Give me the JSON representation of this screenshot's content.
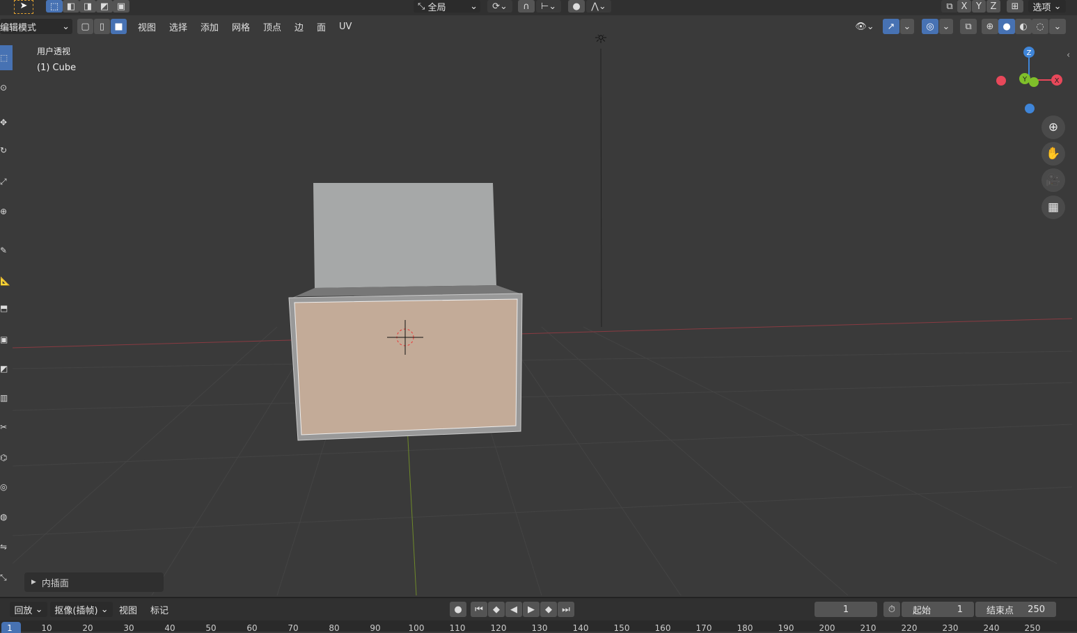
{
  "header": {
    "transform_orientation": "全局",
    "options_label": "选项",
    "axes": [
      "X",
      "Y",
      "Z"
    ]
  },
  "toolbar": {
    "mode": "编辑模式",
    "menus": [
      "视图",
      "选择",
      "添加",
      "网格",
      "顶点",
      "边",
      "面",
      "UV"
    ]
  },
  "viewport": {
    "view_name": "用户透视",
    "object_name": "(1) Cube",
    "gizmo": {
      "z": "Z",
      "y": "Y",
      "x": "X"
    }
  },
  "operator_panel": {
    "label": "内插面"
  },
  "timeline": {
    "menus": [
      "回放",
      "抠像(插帧)",
      "视图",
      "标记"
    ],
    "current_frame": "1",
    "start_label": "起始",
    "start": "1",
    "end_label": "结束点",
    "end": "250",
    "ruler": [
      "1",
      "10",
      "20",
      "30",
      "40",
      "50",
      "60",
      "70",
      "80",
      "90",
      "100",
      "110",
      "120",
      "130",
      "140",
      "150",
      "160",
      "170",
      "180",
      "190",
      "200",
      "210",
      "220",
      "230",
      "240",
      "250"
    ]
  },
  "colors": {
    "accent": "#4772b3",
    "face": "#c3ab98",
    "x_axis": "#e8485a",
    "y_axis": "#7fbf2a",
    "z_axis": "#3f85d8"
  }
}
